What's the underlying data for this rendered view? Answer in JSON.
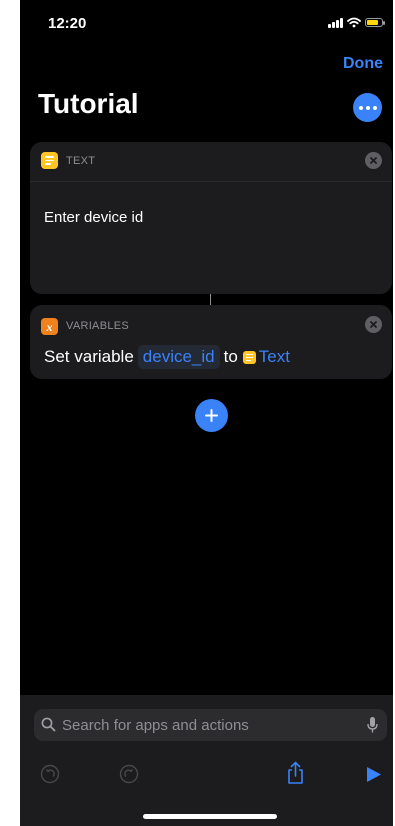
{
  "status_bar": {
    "time": "12:20",
    "icons": [
      "cellular-signal-icon",
      "wifi-icon",
      "battery-icon"
    ],
    "battery_color": "#ffd60a"
  },
  "header": {
    "done_label": "Done",
    "title": "Tutorial",
    "more_icon": "ellipsis-icon"
  },
  "actions": [
    {
      "app": "TEXT",
      "icon": "text-action-icon",
      "icon_color": "#ffc524",
      "body": "Enter device id"
    },
    {
      "app": "VARIABLES",
      "icon": "variables-action-icon",
      "icon_color": "#f0821e",
      "verb": "Set variable",
      "variable_name": "device_id",
      "connector": "to",
      "value_token": "Text"
    }
  ],
  "add_action_icon": "plus-icon",
  "search": {
    "placeholder": "Search for apps and actions",
    "value": ""
  },
  "toolbar": {
    "icons": [
      "undo-icon",
      "redo-icon",
      "share-icon",
      "play-icon"
    ]
  },
  "colors": {
    "accent": "#3a82f7",
    "background": "#000000",
    "card": "#1c1c1e"
  }
}
